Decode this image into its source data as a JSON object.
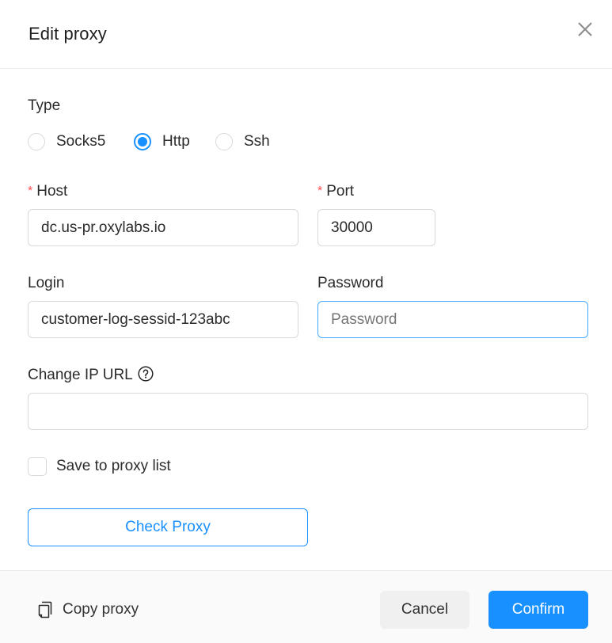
{
  "dialog": {
    "title": "Edit proxy",
    "close_icon": "close-icon"
  },
  "type": {
    "label": "Type",
    "options": [
      {
        "label": "Socks5",
        "checked": false
      },
      {
        "label": "Http",
        "checked": true
      },
      {
        "label": "Ssh",
        "checked": false
      }
    ],
    "selected": "Http"
  },
  "host": {
    "label": "Host",
    "required_mark": "*",
    "value": "dc.us-pr.oxylabs.io"
  },
  "port": {
    "label": "Port",
    "required_mark": "*",
    "value": "30000"
  },
  "login": {
    "label": "Login",
    "value": "customer-log-sessid-123abc"
  },
  "password": {
    "label": "Password",
    "value": "",
    "placeholder": "Password"
  },
  "change_ip_url": {
    "label": "Change IP URL",
    "help_icon": "question-circle-icon",
    "value": "",
    "placeholder": ""
  },
  "save_to_list": {
    "label": "Save to proxy list",
    "checked": false
  },
  "check_proxy": {
    "label": "Check Proxy"
  },
  "footer": {
    "copy_label": "Copy proxy",
    "copy_icon": "copy-icon",
    "cancel_label": "Cancel",
    "confirm_label": "Confirm"
  },
  "colors": {
    "accent": "#1890ff",
    "required": "#ff4d4f",
    "footer_bg": "#fafafa",
    "cancel_bg": "#f0f0f0"
  }
}
